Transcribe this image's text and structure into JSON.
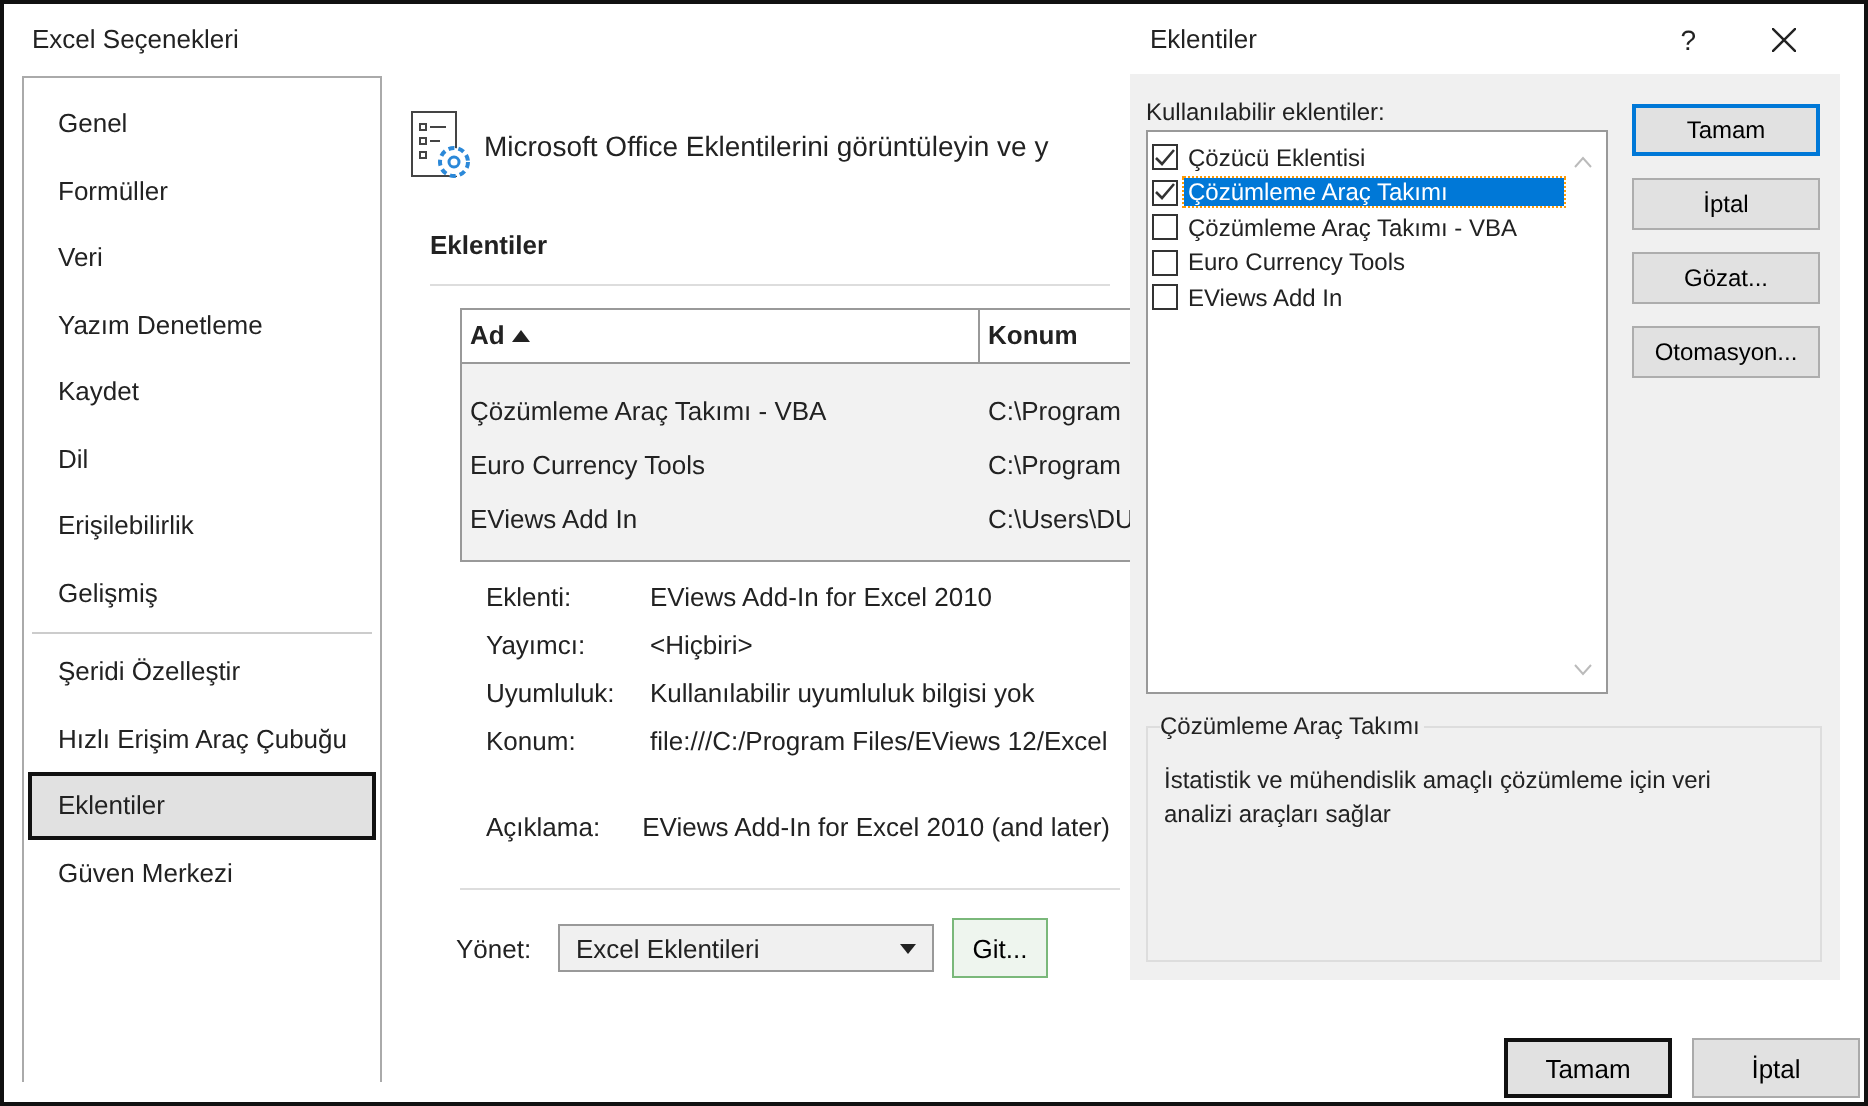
{
  "window": {
    "title": "Excel Seçenekleri"
  },
  "sidebar": {
    "groups": [
      [
        {
          "label": "Genel",
          "selected": false
        },
        {
          "label": "Formüller",
          "selected": false
        },
        {
          "label": "Veri",
          "selected": false
        },
        {
          "label": "Yazım Denetleme",
          "selected": false
        },
        {
          "label": "Kaydet",
          "selected": false
        },
        {
          "label": "Dil",
          "selected": false
        },
        {
          "label": "Erişilebilirlik",
          "selected": false
        },
        {
          "label": "Gelişmiş",
          "selected": false
        }
      ],
      [
        {
          "label": "Şeridi Özelleştir",
          "selected": false
        },
        {
          "label": "Hızlı Erişim Araç Çubuğu",
          "selected": false
        },
        {
          "label": "Eklentiler",
          "selected": true
        },
        {
          "label": "Güven Merkezi",
          "selected": false
        }
      ]
    ]
  },
  "header": "Microsoft Office Eklentilerini görüntüleyin ve y",
  "section_title": "Eklentiler",
  "table": {
    "columns": [
      "Ad",
      "Konum"
    ],
    "rows": [
      {
        "name": "Çözümleme Araç Takımı - VBA",
        "location": "C:\\Program"
      },
      {
        "name": "Euro Currency Tools",
        "location": "C:\\Program"
      },
      {
        "name": "EViews Add In",
        "location": "C:\\Users\\DU"
      }
    ]
  },
  "details": [
    {
      "label": "Eklenti:",
      "value": "EViews Add-In for Excel 2010"
    },
    {
      "label": "Yayımcı:",
      "value": "<Hiçbiri>"
    },
    {
      "label": "Uyumluluk:",
      "value": "Kullanılabilir uyumluluk bilgisi yok"
    },
    {
      "label": "Konum:",
      "value": "file:///C:/Program Files/EViews 12/Excel"
    }
  ],
  "description": {
    "label": "Açıklama:",
    "value": "EViews Add-In for Excel 2010 (and later)"
  },
  "manage": {
    "label": "Yönet:",
    "value": "Excel Eklentileri",
    "go": "Git..."
  },
  "buttons": [
    "Tamam",
    "İptal"
  ],
  "dialog": {
    "title": "Eklentiler",
    "help": "?",
    "list_label": "Kullanılabilir eklentiler:",
    "items": [
      {
        "label": "Çözücü Eklentisi",
        "checked": true,
        "selected": false
      },
      {
        "label": "Çözümleme Araç Takımı",
        "checked": true,
        "selected": true
      },
      {
        "label": "Çözümleme Araç Takımı - VBA",
        "checked": false,
        "selected": false
      },
      {
        "label": "Euro Currency Tools",
        "checked": false,
        "selected": false
      },
      {
        "label": "EViews Add In",
        "checked": false,
        "selected": false
      }
    ],
    "buttons": [
      "Tamam",
      "İptal",
      "Gözat...",
      "Otomasyon..."
    ],
    "group_title": "Çözümleme Araç Takımı",
    "group_text": "İstatistik ve mühendislik amaçlı çözümleme için veri analizi araçları sağlar"
  }
}
